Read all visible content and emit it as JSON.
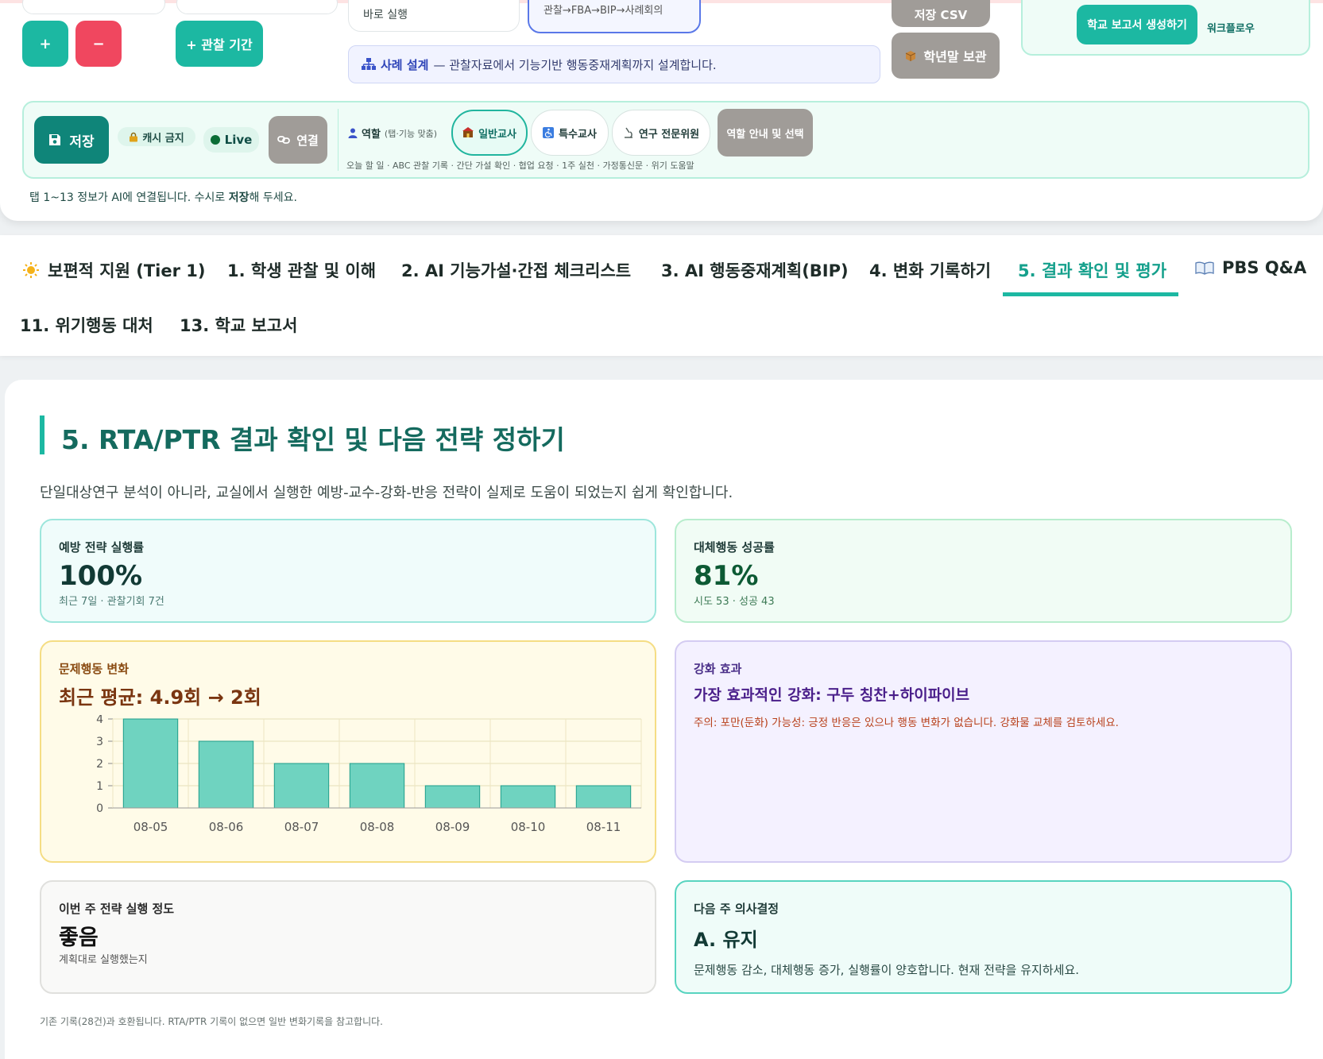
{
  "top": {
    "plus_label": "+",
    "minus_label": "−",
    "add_period_label": "+ 관찰 기간",
    "run_now": "바로 실행",
    "flow_text": "관찰→FBA→BIP→사례회의",
    "csv_label": "저장 CSV",
    "archive_label": "학년말 보관",
    "report_button": "학교 보고서 생성하기",
    "workflow_label": "워크플로우",
    "case_design_title": "사례 설계",
    "case_design_desc": "— 관찰자료에서 기능기반 행동중재계획까지 설계합니다."
  },
  "session": {
    "save_label": "저장",
    "cache_label": "캐시 금지",
    "live_label": "Live",
    "connect_label": "연결",
    "role_label": "역할",
    "role_hint": "(탭·기능 맞춤)",
    "roles": [
      "일반교사",
      "특수교사",
      "연구 전문위원"
    ],
    "role_guide": "역할 안내 및 선택",
    "today_tasks": "오늘 할 일 · ABC 관찰 기록 · 간단 가설 확인 · 협업 요청 · 1주 실천 · 가정통신문 · 위기 도움말",
    "notice_prefix": "탭 1~13 정보가 AI에 연결됩니다. 수시로 ",
    "notice_bold": "저장",
    "notice_suffix": "해 두세요."
  },
  "tabs": [
    "보편적 지원 (Tier 1)",
    "1. 학생 관찰 및 이해",
    "2. AI 기능가설·간접 체크리스트",
    "3. AI 행동중재계획(BIP)",
    "4. 변화 기록하기",
    "5. 결과 확인 및 평가",
    "PBS Q&A",
    "11. 위기행동 대처",
    "13. 학교 보고서"
  ],
  "main": {
    "title": "5. RTA/PTR 결과 확인 및 다음 전략 정하기",
    "desc": "단일대상연구 분석이 아니라, 교실에서 실행한 예방-교수-강화-반응 전략이 실제로 도움이 되었는지 쉽게 확인합니다.",
    "prevention": {
      "label": "예방 전략 실행률",
      "value": "100%",
      "sub": "최근 7일 · 관찰기회 7건"
    },
    "replacement": {
      "label": "대체행동 성공률",
      "value": "81%",
      "sub": "시도 53 · 성공 43"
    },
    "problem": {
      "label": "문제행동 변화",
      "value": "최근 평균: 4.9회 → 2회"
    },
    "reinforce": {
      "label": "강화 효과",
      "value": "가장 효과적인 강화: 구두 칭찬+하이파이브",
      "note": "주의: 포만(둔화) 가능성: 긍정 반응은 있으나 행동 변화가 없습니다. 강화물 교체를 검토하세요."
    },
    "fidelity": {
      "label": "이번 주 전략 실행 정도",
      "value": "좋음",
      "sub": "계획대로 실행했는지"
    },
    "decision": {
      "label": "다음 주 의사결정",
      "value": "A. 유지",
      "sub": "문제행동 감소, 대체행동 증가, 실행률이 양호합니다. 현재 전략을 유지하세요."
    },
    "footnote": "기존 기록(28건)과 호환됩니다. RTA/PTR 기록이 없으면 일반 변화기록을 참고합니다."
  },
  "chart_data": {
    "type": "bar",
    "categories": [
      "08-05",
      "08-06",
      "08-07",
      "08-08",
      "08-09",
      "08-10",
      "08-11"
    ],
    "values": [
      4,
      3,
      2,
      2,
      1,
      1,
      1
    ],
    "ylim": [
      0,
      4
    ],
    "yticks": [
      "0",
      "1",
      "2",
      "3",
      "4"
    ],
    "grid": true,
    "bar_color": "#6fd3c0",
    "bar_stroke": "#1f9e8a"
  },
  "colors": {
    "accent": "#1cb8a2",
    "danger": "#f0475f",
    "brand_dark": "#0f8579"
  }
}
